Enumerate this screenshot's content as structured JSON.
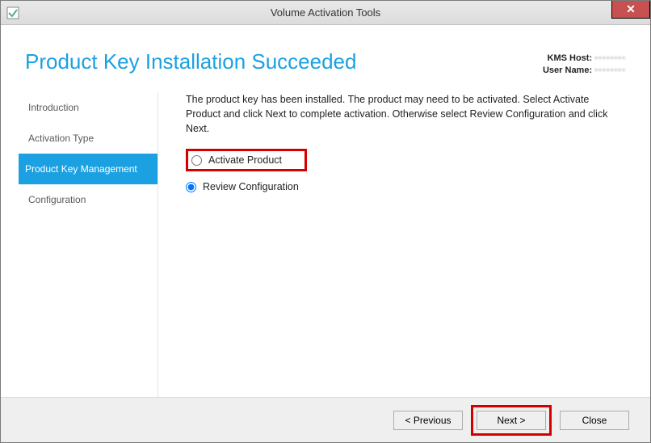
{
  "window": {
    "title": "Volume Activation Tools"
  },
  "header": {
    "page_title": "Product Key Installation Succeeded",
    "kms_host_label": "KMS Host:",
    "kms_host_value": "••••••••",
    "user_name_label": "User Name:",
    "user_name_value": "••••••••"
  },
  "sidebar": {
    "items": [
      {
        "label": "Introduction"
      },
      {
        "label": "Activation Type"
      },
      {
        "label": "Product Key Management"
      },
      {
        "label": "Configuration"
      }
    ]
  },
  "main": {
    "instructions": "The product key has been installed. The product may need to be activated. Select Activate Product and click Next to complete activation. Otherwise select Review Configuration and click Next.",
    "option_activate": "Activate Product",
    "option_review": "Review Configuration"
  },
  "footer": {
    "previous": "< Previous",
    "next": "Next >",
    "close": "Close"
  }
}
